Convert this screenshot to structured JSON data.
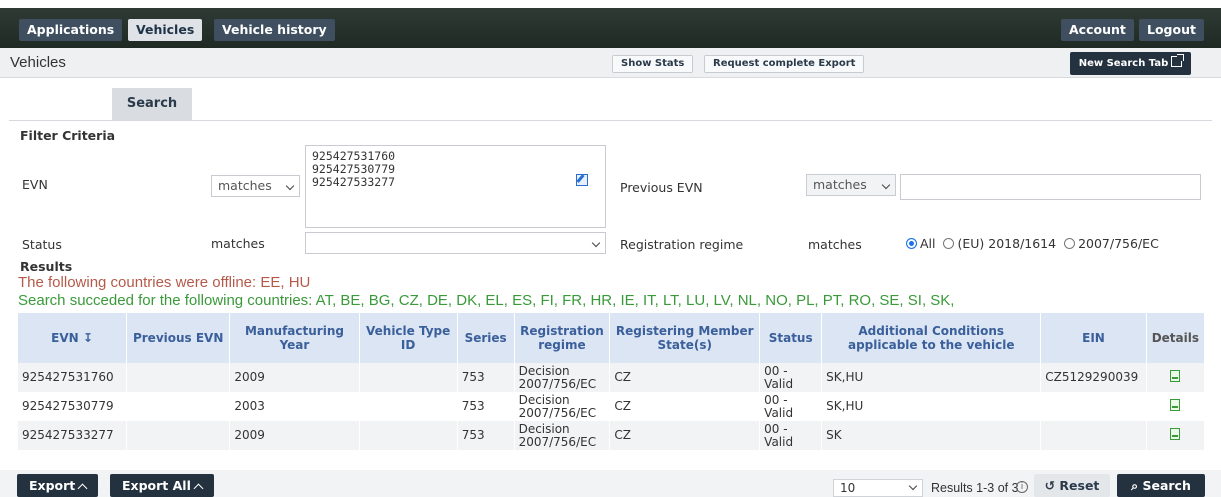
{
  "nav": {
    "applications": "Applications",
    "vehicles": "Vehicles",
    "vehicle_history": "Vehicle history",
    "account": "Account",
    "logout": "Logout"
  },
  "title": {
    "page": "Vehicles",
    "show_stats": "Show Stats",
    "request_export": "Request complete Export",
    "new_search_tab": "New Search Tab"
  },
  "tabs": {
    "search": "Search"
  },
  "filter": {
    "heading": "Filter Criteria",
    "evn_label": "EVN",
    "evn_operator": "matches",
    "evn_values": [
      "925427531760",
      "925427530779",
      "925427533277"
    ],
    "prev_evn_label": "Previous EVN",
    "prev_evn_operator": "matches",
    "prev_evn_value": "",
    "status_label": "Status",
    "status_operator": "matches",
    "status_value": "",
    "regime_label": "Registration regime",
    "regime_operator": "matches",
    "regime_options": [
      "All",
      "(EU) 2018/1614",
      "2007/756/EC"
    ],
    "regime_selected": "All"
  },
  "results": {
    "heading": "Results",
    "offline": "The following countries were offline:  EE, HU",
    "success": "Search succeded for the following countries: AT, BE, BG, CZ, DE, DK, EL, ES, FI, FR, HR, IE, IT, LT, LU, LV, NL, NO, PL, PT, RO, SE, SI, SK,",
    "columns": [
      "EVN ↧",
      "Previous EVN",
      "Manufacturing Year",
      "Vehicle Type ID",
      "Series",
      "Registration regime",
      "Registering Member State(s)",
      "Status",
      "Additional Conditions applicable to the vehicle",
      "EIN",
      "Details"
    ],
    "rows": [
      {
        "evn": "925427531760",
        "prev": "",
        "year": "2009",
        "type": "",
        "series": "753",
        "regime": "Decision 2007/756/EC",
        "ms": "CZ",
        "status": "00 - Valid",
        "cond": "SK,HU",
        "ein": "CZ5129290039"
      },
      {
        "evn": "925427530779",
        "prev": "",
        "year": "2003",
        "type": "",
        "series": "753",
        "regime": "Decision 2007/756/EC",
        "ms": "CZ",
        "status": "00 - Valid",
        "cond": "SK,HU",
        "ein": ""
      },
      {
        "evn": "925427533277",
        "prev": "",
        "year": "2009",
        "type": "",
        "series": "753",
        "regime": "Decision 2007/756/EC",
        "ms": "CZ",
        "status": "00 - Valid",
        "cond": "SK",
        "ein": ""
      }
    ]
  },
  "footer": {
    "export": "Export",
    "export_all": "Export All",
    "page_size": "10",
    "results_text": "Results 1-3 of 3",
    "reset": "↺ Reset",
    "search": "⌕ Search"
  }
}
